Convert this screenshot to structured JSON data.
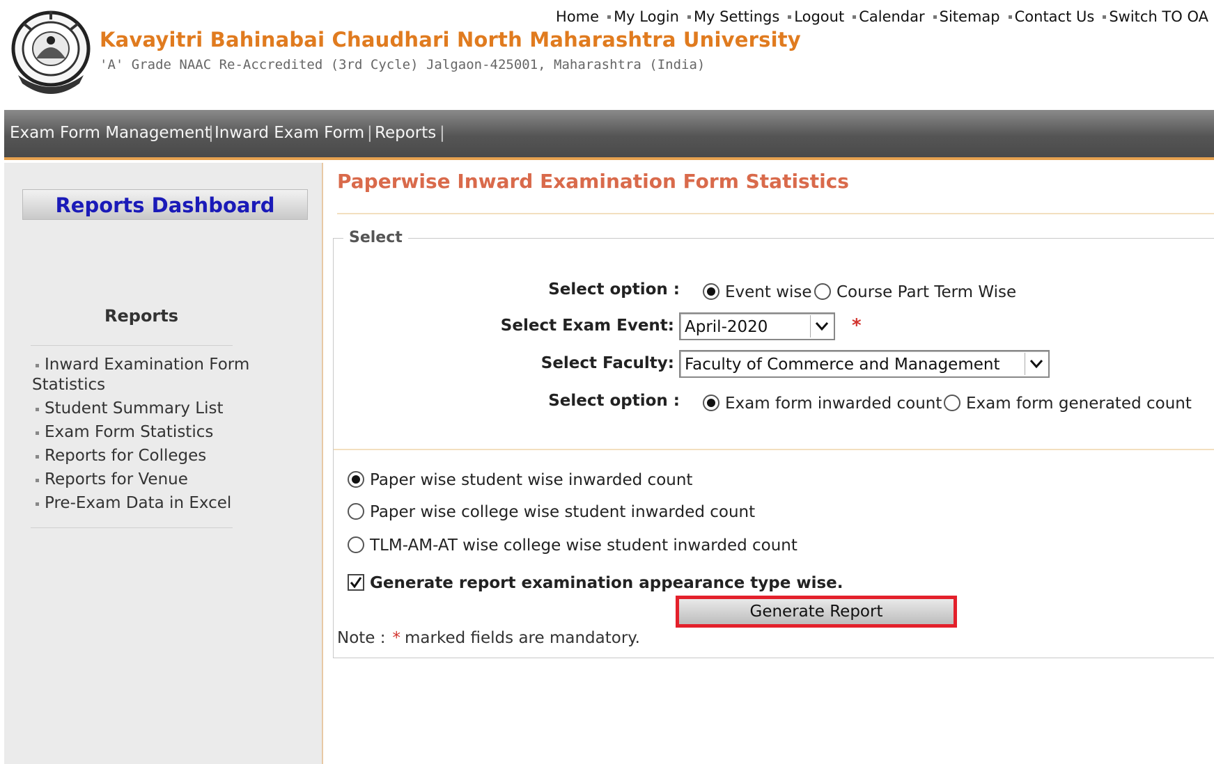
{
  "header": {
    "university_name": "Kavayitri Bahinabai Chaudhari North Maharashtra University",
    "subtitle": "'A' Grade NAAC Re-Accredited (3rd Cycle) Jalgaon-425001, Maharashtra (India)",
    "top_links": [
      "Home",
      "My Login",
      "My Settings",
      "Logout",
      "Calendar",
      "Sitemap",
      "Contact Us",
      "Switch TO OA"
    ]
  },
  "nav": {
    "items": [
      "Exam Form Management",
      "Inward Exam Form",
      "Reports"
    ],
    "separator": "|"
  },
  "sidebar": {
    "dashboard_label": "Reports Dashboard",
    "section_title": "Reports",
    "items": [
      {
        "label_line1": "Inward Examination Form",
        "label_line2": "Statistics"
      },
      {
        "label": "Student Summary List"
      },
      {
        "label": "Exam Form Statistics"
      },
      {
        "label": "Reports for Colleges"
      },
      {
        "label": "Reports for Venue"
      },
      {
        "label": "Pre-Exam Data in Excel"
      }
    ]
  },
  "main": {
    "page_title": "Paperwise Inward Examination Form Statistics",
    "legend": "Select",
    "option1": {
      "label": "Select option :",
      "choices": [
        "Event wise",
        "Course Part Term Wise"
      ],
      "selected": "Event wise"
    },
    "exam_event": {
      "label": "Select Exam Event:",
      "value": "April-2020",
      "required_mark": "*"
    },
    "faculty": {
      "label": "Select Faculty:",
      "value": "Faculty of Commerce and Management"
    },
    "option2": {
      "label": "Select option :",
      "choices": [
        "Exam form inwarded count",
        "Exam form generated count"
      ],
      "selected": "Exam form inwarded count"
    },
    "report_types": {
      "choices": [
        "Paper wise student wise inwarded count",
        "Paper wise college wise student inwarded count",
        "TLM-AM-AT wise college wise student inwarded count"
      ],
      "selected": "Paper wise student wise inwarded count"
    },
    "appearance_checkbox": {
      "label": "Generate report examination appearance type wise.",
      "checked": true
    },
    "generate_button": "Generate Report",
    "note": {
      "prefix": "Note :",
      "star": "*",
      "text": "marked fields are mandatory."
    }
  },
  "colors": {
    "university_name": "#e07b1f",
    "page_title": "#d96a4b",
    "dashboard_text": "#1a1ab8",
    "highlight_border": "#e3202b",
    "nav_bottom_border": "#e6a14f"
  }
}
